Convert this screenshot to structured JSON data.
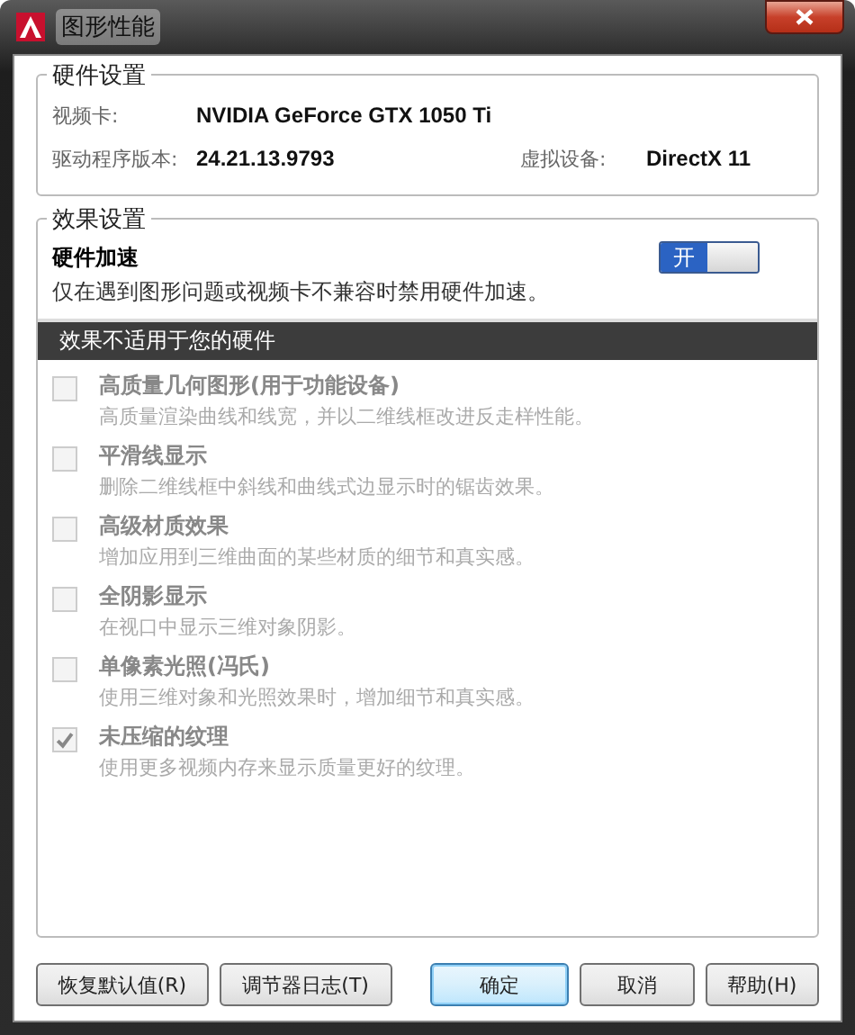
{
  "window": {
    "title": "图形性能"
  },
  "hardware": {
    "title": "硬件设置",
    "rows": [
      {
        "label": "视频卡:",
        "value": "NVIDIA GeForce GTX 1050 Ti"
      },
      {
        "label": "驱动程序版本:",
        "value": "24.21.13.9793",
        "label2": "虚拟设备:",
        "value2": "DirectX 11"
      }
    ]
  },
  "effects": {
    "title": "效果设置",
    "accel_title": "硬件加速",
    "accel_note": "仅在遇到图形问题或视频卡不兼容时禁用硬件加速。",
    "toggle": {
      "label": "开",
      "on": true
    },
    "section_header": "效果不适用于您的硬件",
    "items": [
      {
        "title": "高质量几何图形(用于功能设备)",
        "description": "高质量渲染曲线和线宽，并以二维线框改进反走样性能。",
        "checked": false,
        "disabled": true
      },
      {
        "title": "平滑线显示",
        "description": "删除二维线框中斜线和曲线式边显示时的锯齿效果。",
        "checked": false,
        "disabled": true
      },
      {
        "title": "高级材质效果",
        "description": "增加应用到三维曲面的某些材质的细节和真实感。",
        "checked": false,
        "disabled": true
      },
      {
        "title": "全阴影显示",
        "description": "在视口中显示三维对象阴影。",
        "checked": false,
        "disabled": true
      },
      {
        "title": "单像素光照(冯氏)",
        "description": "使用三维对象和光照效果时，增加细节和真实感。",
        "checked": false,
        "disabled": true
      },
      {
        "title": "未压缩的纹理",
        "description": "使用更多视频内存来显示质量更好的纹理。",
        "checked": true,
        "disabled": true
      }
    ]
  },
  "buttons": [
    {
      "label": "恢复默认值(R)",
      "default": false
    },
    {
      "label": "调节器日志(T)",
      "default": false
    },
    {
      "label": "确定",
      "default": true
    },
    {
      "label": "取消",
      "default": false
    },
    {
      "label": "帮助(H)",
      "default": false
    }
  ]
}
